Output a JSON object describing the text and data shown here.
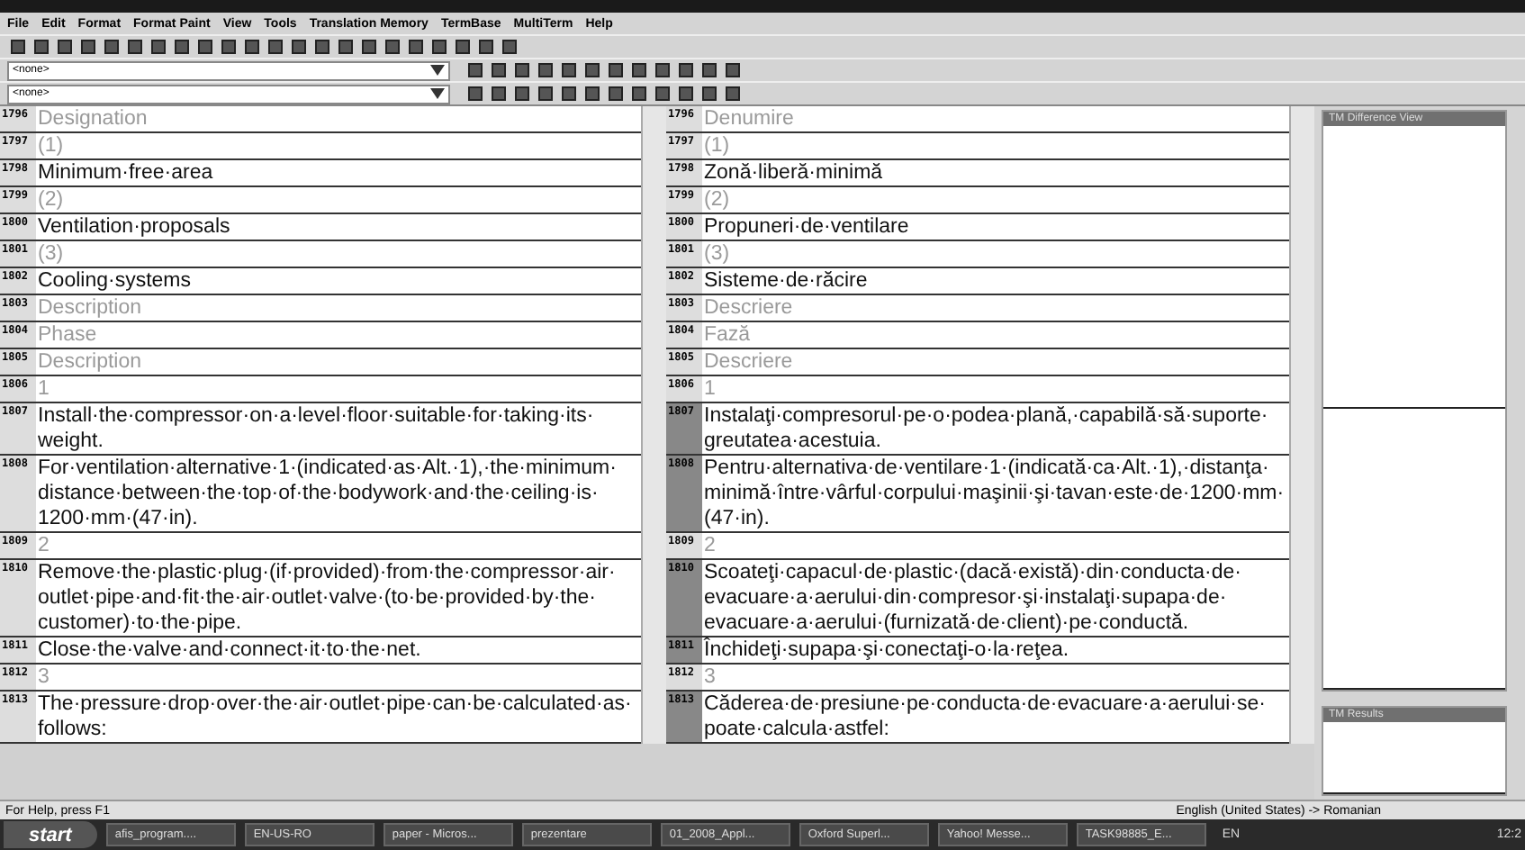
{
  "menu": [
    "File",
    "Edit",
    "Format",
    "Format Paint",
    "View",
    "Tools",
    "Translation Memory",
    "TermBase",
    "MultiTerm",
    "Help"
  ],
  "toolbars": [
    {
      "combo": "<none>"
    },
    {
      "combo": "<none>"
    }
  ],
  "rows": [
    {
      "number_source": "1796",
      "source": "Designation",
      "number_target": "1796",
      "target": "Denumire",
      "kind": "tag",
      "confirmed": false
    },
    {
      "number_source": "1797",
      "source": "(1)",
      "number_target": "1797",
      "target": "(1)",
      "kind": "tag",
      "confirmed": false
    },
    {
      "number_source": "1798",
      "source": "Minimum·free·area",
      "number_target": "1798",
      "target": "Zonă·liberă·minimă",
      "kind": "text",
      "confirmed": false
    },
    {
      "number_source": "1799",
      "source": "(2)",
      "number_target": "1799",
      "target": "(2)",
      "kind": "tag",
      "confirmed": false
    },
    {
      "number_source": "1800",
      "source": "Ventilation·proposals",
      "number_target": "1800",
      "target": "Propuneri·de·ventilare",
      "kind": "text",
      "confirmed": false
    },
    {
      "number_source": "1801",
      "source": "(3)",
      "number_target": "1801",
      "target": "(3)",
      "kind": "tag",
      "confirmed": false
    },
    {
      "number_source": "1802",
      "source": "Cooling·systems",
      "number_target": "1802",
      "target": "Sisteme·de·răcire",
      "kind": "text",
      "confirmed": false
    },
    {
      "number_source": "1803",
      "source": "Description",
      "number_target": "1803",
      "target": "Descriere",
      "kind": "tag",
      "confirmed": false
    },
    {
      "number_source": "1804",
      "source": "Phase",
      "number_target": "1804",
      "target": "Fază",
      "kind": "tag",
      "confirmed": false
    },
    {
      "number_source": "1805",
      "source": "Description",
      "number_target": "1805",
      "target": "Descriere",
      "kind": "tag",
      "confirmed": false
    },
    {
      "number_source": "1806",
      "source": "1",
      "number_target": "1806",
      "target": "1",
      "kind": "tag",
      "confirmed": false
    },
    {
      "number_source": "1807",
      "source": "Install·the·compressor·on·a·level·floor·suitable·for·taking·its·weight.",
      "number_target": "1807",
      "target": "Instalaţi·compresorul·pe·o·podea·plană,·capabilă·să·suporte·greutatea·acestuia.",
      "kind": "text",
      "confirmed": true
    },
    {
      "number_source": "1808",
      "source": "For·ventilation·alternative·1·(indicated·as·Alt.·1),·the·minimum·distance·between·the·top·of·the·bodywork·and·the·ceiling·is·1200·mm·(47·in).",
      "number_target": "1808",
      "target": "Pentru·alternativa·de·ventilare·1·(indicată·ca·Alt.·1),·distanţa·minimă·între·vârful·corpului·maşinii·şi·tavan·este·de·1200·mm·(47·in).",
      "kind": "text",
      "confirmed": true
    },
    {
      "number_source": "1809",
      "source": "2",
      "number_target": "1809",
      "target": "2",
      "kind": "tag",
      "confirmed": false
    },
    {
      "number_source": "1810",
      "source": "Remove·the·plastic·plug·(if·provided)·from·the·compressor·air·outlet·pipe·and·fit·the·air·outlet·valve·(to·be·provided·by·the·customer)·to·the·pipe.",
      "number_target": "1810",
      "target": "Scoateţi·capacul·de·plastic·(dacă·există)·din·conducta·de·evacuare·a·aerului·din·compresor·şi·instalaţi·supapa·de·evacuare·a·aerului·(furnizată·de·client)·pe·conductă.",
      "kind": "text",
      "confirmed": true
    },
    {
      "number_source": "1811",
      "source": "Close·the·valve·and·connect·it·to·the·net.",
      "number_target": "1811",
      "target": "Închideţi·supapa·şi·conectaţi-o·la·reţea.",
      "kind": "text",
      "confirmed": true
    },
    {
      "number_source": "1812",
      "source": "3",
      "number_target": "1812",
      "target": "3",
      "kind": "tag",
      "confirmed": false
    },
    {
      "number_source": "1813",
      "source": "The·pressure·drop·over·the·air·outlet·pipe·can·be·calculated·as·follows:",
      "number_target": "1813",
      "target": "Căderea·de·presiune·pe·conducta·de·evacuare·a·aerului·se·poate·calcula·astfel:",
      "kind": "text",
      "confirmed": true
    }
  ],
  "side_panels": [
    {
      "title": "TM Difference View"
    },
    {
      "title": "TM Results"
    }
  ],
  "status_bar": {
    "help": "For Help, press F1",
    "languages": "English (United States) -> Romanian"
  },
  "taskbar": {
    "start": "start",
    "items": [
      "afis_program....",
      "EN-US-RO",
      "paper - Micros...",
      "prezentare",
      "01_2008_Appl...",
      "Oxford Superl...",
      "Yahoo! Messe...",
      "TASK98885_E..."
    ],
    "language": "EN",
    "clock": "12:2"
  }
}
